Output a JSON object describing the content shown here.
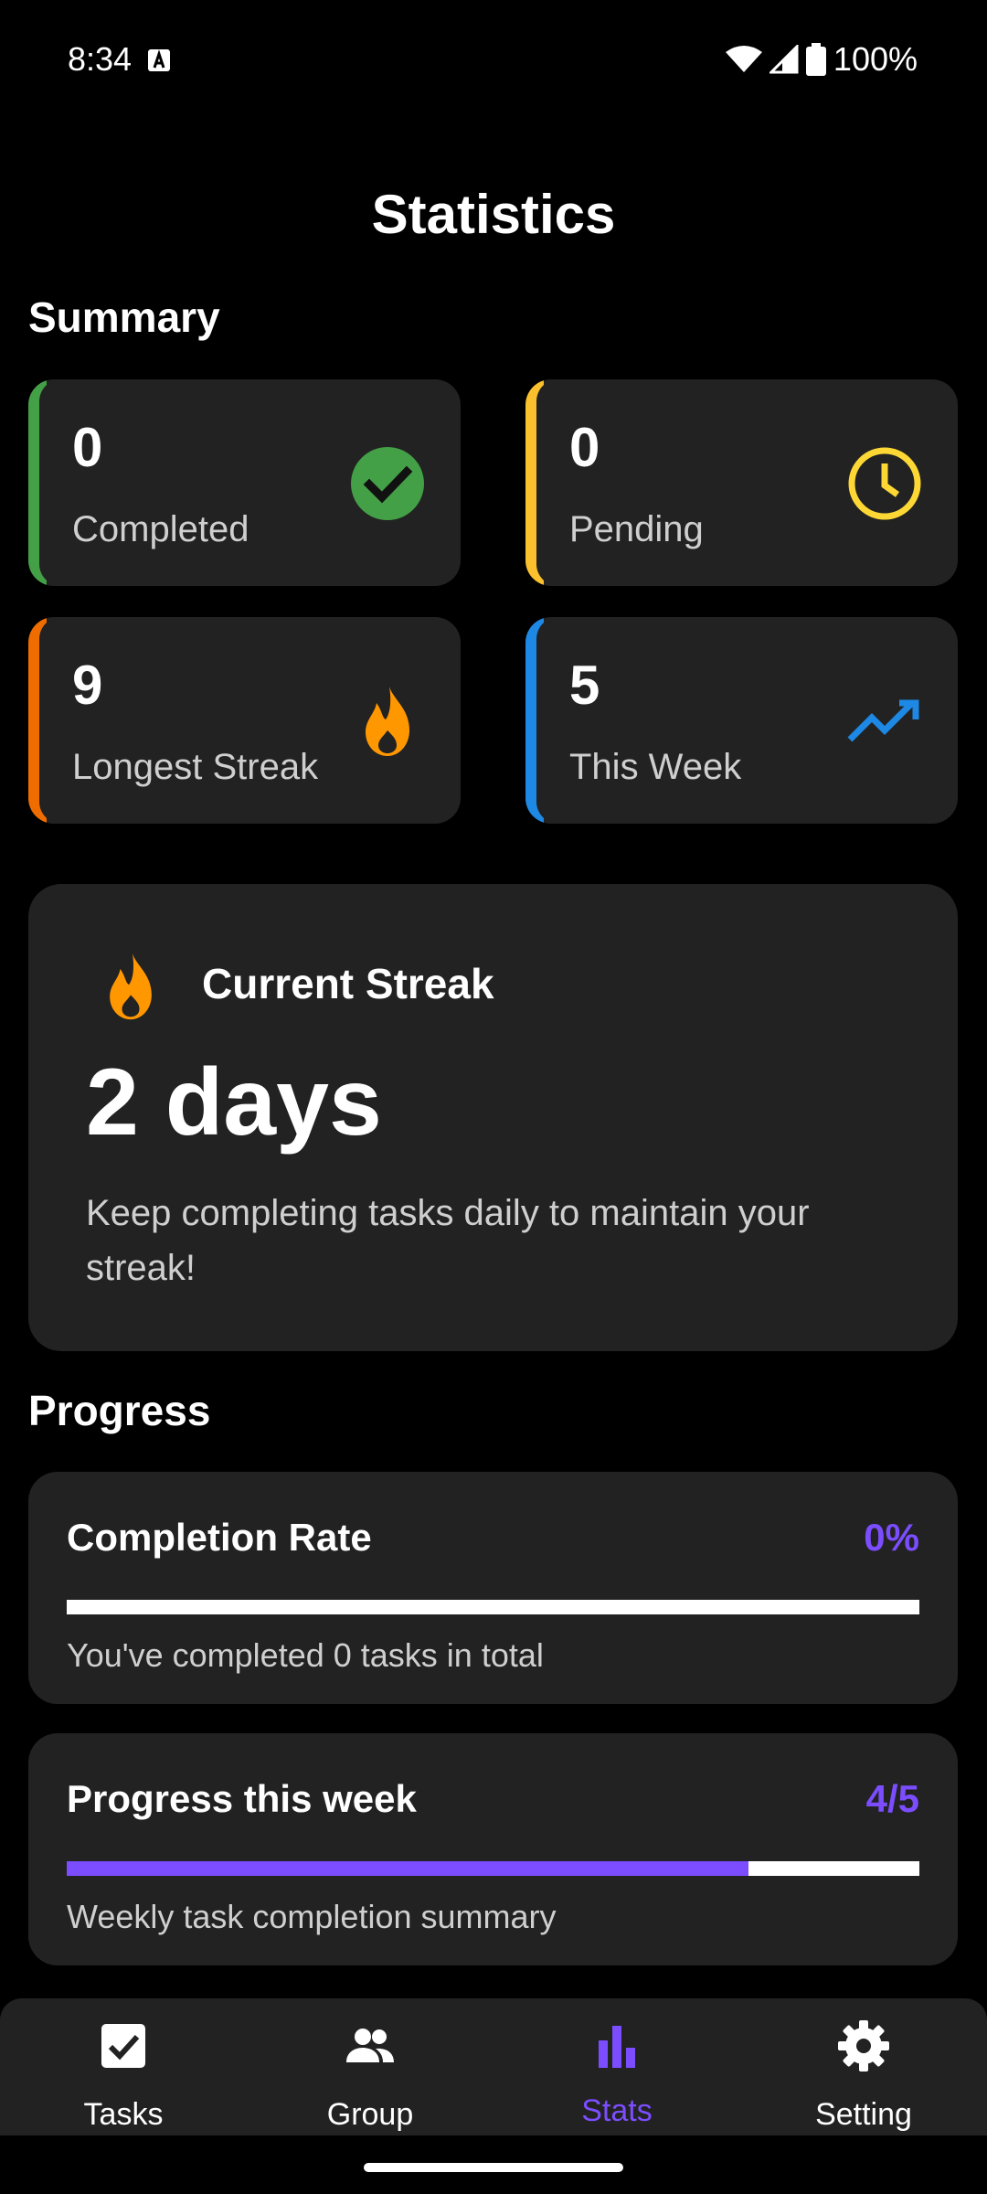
{
  "status_bar": {
    "time": "8:34",
    "battery": "100%"
  },
  "page_title": "Statistics",
  "summary": {
    "title": "Summary",
    "cards": [
      {
        "value": "0",
        "label": "Completed",
        "icon": "check-circle-icon",
        "accent": "#43a047"
      },
      {
        "value": "0",
        "label": "Pending",
        "icon": "clock-icon",
        "accent": "#fbc02d"
      },
      {
        "value": "9",
        "label": "Longest Streak",
        "icon": "fire-icon",
        "accent": "#ef6c00"
      },
      {
        "value": "5",
        "label": "This Week",
        "icon": "trending-up-icon",
        "accent": "#1e88e5"
      }
    ]
  },
  "current_streak": {
    "title": "Current Streak",
    "value": "2 days",
    "description": "Keep completing tasks daily to maintain your streak!"
  },
  "progress": {
    "title": "Progress",
    "completion_rate": {
      "title": "Completion Rate",
      "value": "0%",
      "fraction": 0,
      "description": "You've completed 0 tasks in total"
    },
    "weekly": {
      "title": "Progress this week",
      "value": "4/5",
      "fraction": 0.8,
      "description": "Weekly task completion summary"
    }
  },
  "bottom_nav": {
    "items": [
      {
        "label": "Tasks",
        "icon": "checkbox-icon"
      },
      {
        "label": "Group",
        "icon": "group-icon"
      },
      {
        "label": "Stats",
        "icon": "bar-chart-icon",
        "active": true
      },
      {
        "label": "Setting",
        "icon": "gear-icon"
      }
    ]
  },
  "colors": {
    "accent": "#7b4dff",
    "card_bg": "#222222",
    "fire": "#ff9800"
  }
}
